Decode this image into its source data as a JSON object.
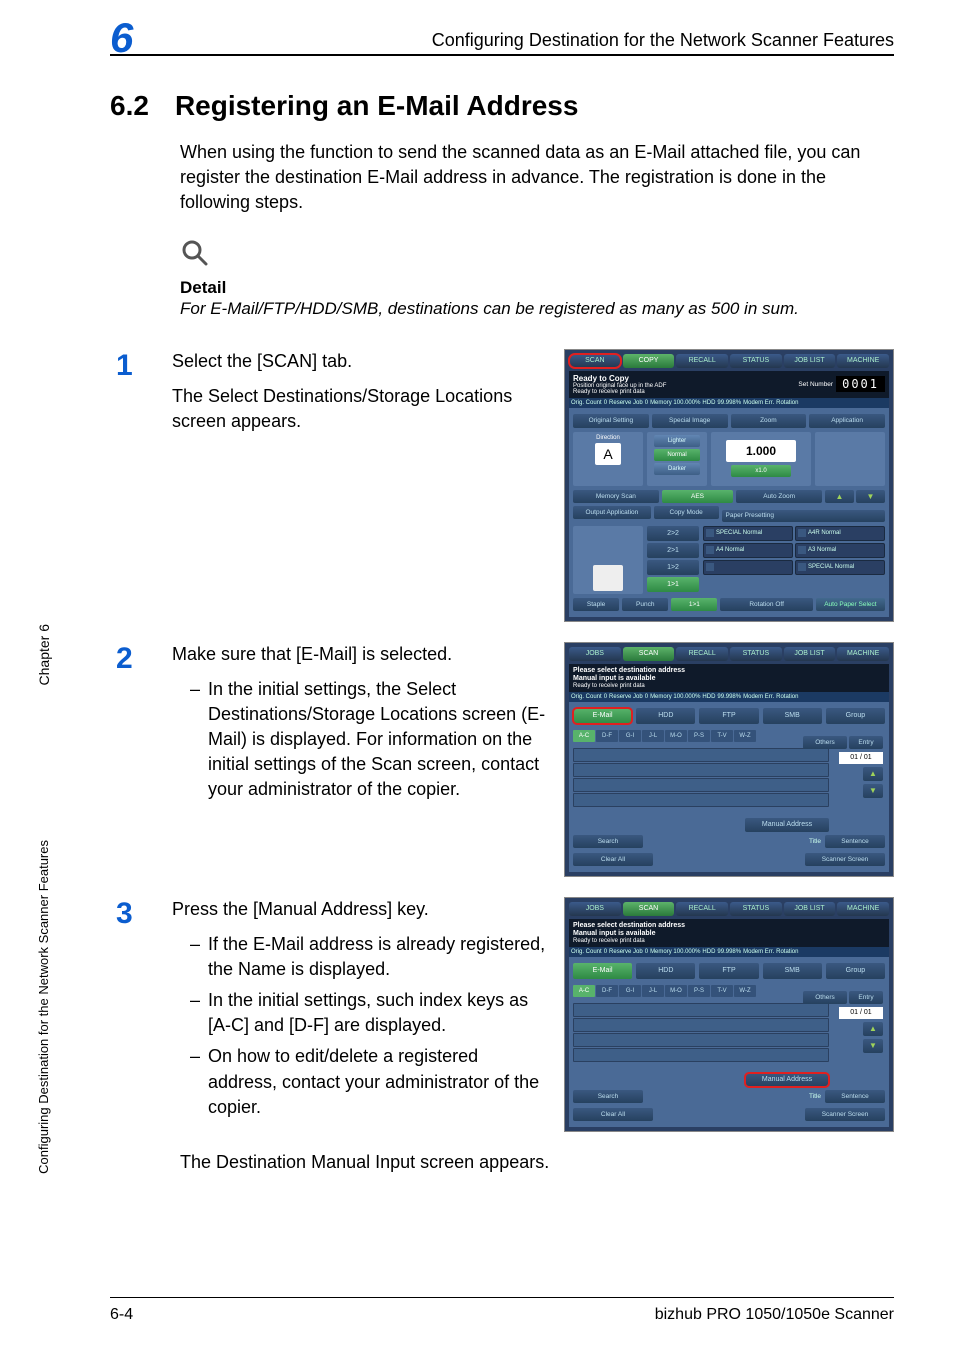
{
  "running_head": "Configuring Destination for the Network Scanner Features",
  "chapter_num": "6",
  "side_chapter": "Chapter 6",
  "side_title": "Configuring Destination for the Network Scanner Features",
  "footer_left": "6-4",
  "footer_right": "bizhub PRO 1050/1050e Scanner",
  "section": {
    "num": "6.2",
    "title": "Registering an E-Mail Address"
  },
  "intro": "When using the function to send the scanned data as an E-Mail attached file, you can register the destination E-Mail address in advance. The registration is done in the following steps.",
  "detail": {
    "label": "Detail",
    "text": "For E-Mail/FTP/HDD/SMB, destinations can be registered as many as 500 in sum."
  },
  "steps": {
    "s1": {
      "num": "1",
      "p1": "Select the [SCAN] tab.",
      "p2": "The Select Destinations/Storage Locations screen appears."
    },
    "s2": {
      "num": "2",
      "p1": "Make sure that [E-Mail] is selected.",
      "b1": "In the initial settings, the Select Destinations/Storage Locations screen (E-Mail) is displayed. For information on the initial settings of the Scan screen, contact your administrator of the copier."
    },
    "s3": {
      "num": "3",
      "p1": "Press the [Manual Address] key.",
      "b1": "If the E-Mail address is already registered, the Name is displayed.",
      "b2": "In the initial settings, such index keys as [A-C] and [D-F] are displayed.",
      "b3": "On how to edit/delete a registered address, contact your administrator of the copier.",
      "after": "The Destination Manual Input screen appears."
    }
  },
  "shot1": {
    "tabs": [
      "SCAN",
      "COPY",
      "RECALL",
      "STATUS",
      "JOB LIST",
      "MACHINE"
    ],
    "ready": "Ready to Copy",
    "pos": "Position original face up in the ADF",
    "rcv": "Ready to receive print data",
    "set_label": "Set Number",
    "set_val": "0001",
    "info": [
      "Orig. Count",
      "0",
      "Reserve Job",
      "0",
      "Memory 100.000%",
      "HDD",
      "99.998%",
      "Modem Err.",
      "Rotation"
    ],
    "row1": [
      "Original Setting",
      "Special Image",
      "Zoom",
      "Application"
    ],
    "direction": "Direction",
    "dir_icon": "A",
    "sp": [
      "Lighter",
      "Normal",
      "Darker"
    ],
    "zoom_val": "1.000",
    "zoom_btn": "x1.0",
    "row3": [
      "Memory Scan",
      "AES",
      "Auto Zoom"
    ],
    "paper": [
      "Output Application",
      "Copy Mode",
      "Paper Presetting"
    ],
    "copy_modes": [
      "2>2",
      "2>1",
      "1>2",
      "1>1"
    ],
    "trays": [
      "SPECIAL Normal",
      "A4R Normal",
      "A4 Normal",
      "A3 Normal",
      "",
      "SPECIAL Normal"
    ],
    "bot": [
      "Staple",
      "Punch",
      "1>1",
      "Rotation Off",
      "Auto Paper Select"
    ]
  },
  "shot2": {
    "tabs": [
      "JOBS",
      "SCAN",
      "RECALL",
      "STATUS",
      "JOB LIST",
      "MACHINE"
    ],
    "msg1": "Please select destination address",
    "msg2": "Manual input is available",
    "rcv": "Ready to receive print data",
    "info": [
      "Orig. Count",
      "0",
      "Reserve Job",
      "0",
      "Memory 100.000%",
      "HDD",
      "99.998%",
      "Modem Err.",
      "Rotation"
    ],
    "dtabs": [
      "E-Mail",
      "HDD",
      "FTP",
      "SMB",
      "Group"
    ],
    "idx": [
      "A-C",
      "D-F",
      "G-I",
      "J-L",
      "M-O",
      "P-S",
      "T-V",
      "W-Z"
    ],
    "others": "Others",
    "entry": "Entry",
    "page": "01 / 01",
    "manual": "Manual Address",
    "search": "Search",
    "title": "Title",
    "sentence": "Sentence",
    "clear": "Clear All",
    "scanner_screen": "Scanner Screen"
  }
}
